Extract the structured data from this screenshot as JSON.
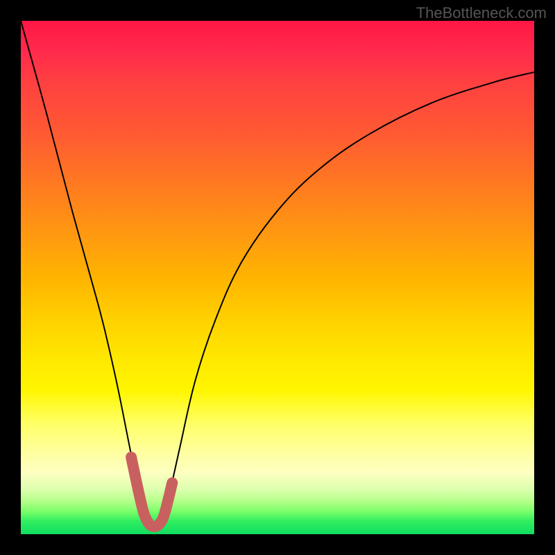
{
  "watermark": "TheBottleneck.com",
  "chart_data": {
    "type": "line",
    "title": "",
    "xlabel": "",
    "ylabel": "",
    "xlim": [
      0,
      100
    ],
    "ylim": [
      0,
      100
    ],
    "grid": false,
    "series": [
      {
        "name": "bottleneck-curve",
        "x": [
          0,
          5,
          10,
          15,
          17,
          19,
          21,
          23,
          24,
          25,
          26,
          27,
          28,
          29,
          31,
          34,
          38,
          43,
          50,
          58,
          68,
          80,
          92,
          100
        ],
        "y": [
          100,
          82,
          63,
          45,
          37,
          28,
          18,
          8,
          4,
          2,
          1.5,
          2,
          4,
          8,
          17,
          30,
          42,
          53,
          63,
          71,
          78,
          84,
          88,
          90
        ]
      }
    ],
    "highlight": {
      "name": "optimal-zone",
      "x": [
        21.5,
        23,
        24,
        25,
        26,
        27,
        28,
        29.5
      ],
      "y": [
        15,
        8,
        4,
        2,
        1.5,
        2,
        4,
        10
      ]
    },
    "gradient_stops": [
      {
        "pos": 0,
        "color": "#ff1744"
      },
      {
        "pos": 50,
        "color": "#ffb400"
      },
      {
        "pos": 78,
        "color": "#ffffa0"
      },
      {
        "pos": 100,
        "color": "#10dd60"
      }
    ]
  }
}
